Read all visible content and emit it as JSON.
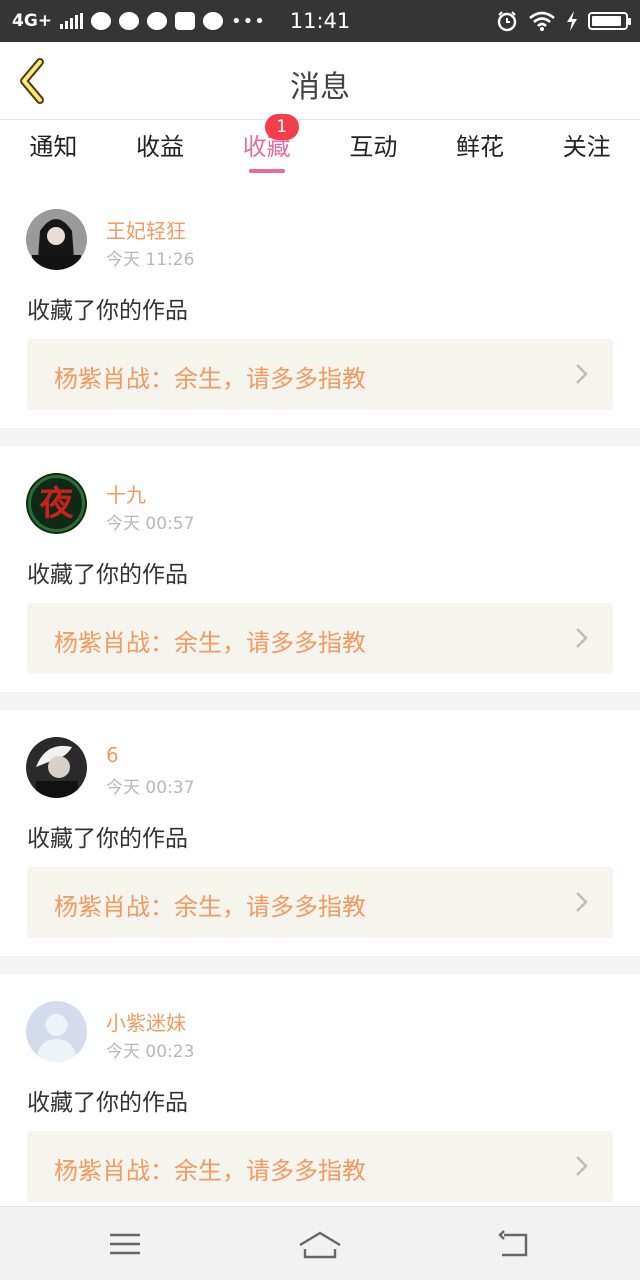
{
  "status_bar": {
    "network": "4G+",
    "time": "11:41",
    "icons": [
      "signal-icon",
      "app-icon",
      "weibo-icon",
      "wechat-icon",
      "mail-icon",
      "message-icon",
      "more-icon",
      "alarm-icon",
      "wifi-icon",
      "charging-icon",
      "battery-icon"
    ]
  },
  "header": {
    "title": "消息",
    "back_icon": "back-arrow-icon"
  },
  "tabs": [
    {
      "label": "通知"
    },
    {
      "label": "收益"
    },
    {
      "label": "收藏",
      "badge": "1",
      "active": true
    },
    {
      "label": "互动"
    },
    {
      "label": "鲜花"
    },
    {
      "label": "关注"
    }
  ],
  "messages": [
    {
      "user": "王妃轻狂",
      "time": "今天 11:26",
      "action": "收藏了你的作品",
      "work": "杨紫肖战：余生，请多多指教"
    },
    {
      "user": "十九",
      "time": "今天 00:57",
      "action": "收藏了你的作品",
      "work": "杨紫肖战：余生，请多多指教"
    },
    {
      "user": "6",
      "time": "今天 00:37",
      "action": "收藏了你的作品",
      "work": "杨紫肖战：余生，请多多指教"
    },
    {
      "user": "小紫迷妹",
      "time": "今天 00:23",
      "action": "收藏了你的作品",
      "work": "杨紫肖战：余生，请多多指教"
    }
  ],
  "nav": {
    "icons": [
      "menu-icon",
      "home-icon",
      "back-icon"
    ]
  },
  "colors": {
    "accent": "#e66da1",
    "username": "#f29a62",
    "badge": "#f33e4e",
    "link_bg": "#f5f5ee"
  }
}
